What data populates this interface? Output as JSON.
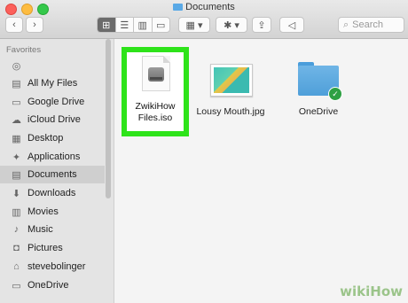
{
  "window": {
    "title": "Documents"
  },
  "toolbar": {
    "back_icon": "‹",
    "forward_icon": "›",
    "view_icons": [
      "⊞",
      "☰",
      "▥",
      "▭"
    ],
    "arrange_label": "▦ ▾",
    "action_label": "✱ ▾",
    "share_icon": "⇪",
    "tag_icon": "◁"
  },
  "search": {
    "placeholder": "Search",
    "icon": "⌕"
  },
  "sidebar": {
    "header": "Favorites",
    "items": [
      {
        "label": "",
        "icon": "◎"
      },
      {
        "label": "All My Files",
        "icon": "▤"
      },
      {
        "label": "Google Drive",
        "icon": "▭"
      },
      {
        "label": "iCloud Drive",
        "icon": "☁"
      },
      {
        "label": "Desktop",
        "icon": "▦"
      },
      {
        "label": "Applications",
        "icon": "✦"
      },
      {
        "label": "Documents",
        "icon": "▤"
      },
      {
        "label": "Downloads",
        "icon": "⬇"
      },
      {
        "label": "Movies",
        "icon": "▥"
      },
      {
        "label": "Music",
        "icon": "♪"
      },
      {
        "label": "Pictures",
        "icon": "◘"
      },
      {
        "label": "stevebolinger",
        "icon": "⌂"
      },
      {
        "label": "OneDrive",
        "icon": "▭"
      }
    ]
  },
  "files": [
    {
      "name": "ZwikiHow Files.iso",
      "line1": "ZwikiHow",
      "line2": "Files.iso",
      "selected": true
    },
    {
      "name": "Lousy Mouth.jpg"
    },
    {
      "name": "OneDrive",
      "status_icon": "✓"
    }
  ],
  "colors": {
    "highlight": "#2ee31a",
    "folder": "#5aa9e6",
    "badge": "#2ea043"
  },
  "watermark": "wikiHow"
}
